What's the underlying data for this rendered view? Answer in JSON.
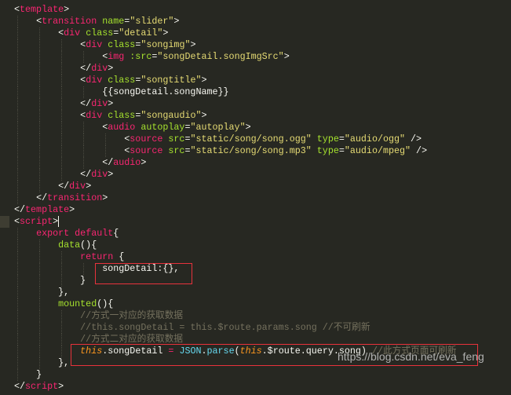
{
  "colors": {
    "background": "#272822",
    "tag": "#F92672",
    "attribute": "#A6E22E",
    "string": "#E6DB74",
    "comment": "#75715E",
    "highlight_box": "#e8323c"
  },
  "code_lines": [
    {
      "indent": 0,
      "tokens": [
        [
          "txt",
          "<"
        ],
        [
          "tag",
          "template"
        ],
        [
          "txt",
          ">"
        ]
      ]
    },
    {
      "indent": 1,
      "tokens": [
        [
          "txt",
          "<"
        ],
        [
          "tag",
          "transition"
        ],
        [
          "txt",
          " "
        ],
        [
          "attr",
          "name"
        ],
        [
          "txt",
          "="
        ],
        [
          "str",
          "\"slider\""
        ],
        [
          "txt",
          ">"
        ]
      ]
    },
    {
      "indent": 2,
      "tokens": [
        [
          "txt",
          "<"
        ],
        [
          "tag",
          "div"
        ],
        [
          "txt",
          " "
        ],
        [
          "attr",
          "class"
        ],
        [
          "txt",
          "="
        ],
        [
          "str",
          "\"detail\""
        ],
        [
          "txt",
          ">"
        ]
      ]
    },
    {
      "indent": 3,
      "tokens": [
        [
          "txt",
          "<"
        ],
        [
          "tag",
          "div"
        ],
        [
          "txt",
          " "
        ],
        [
          "attr",
          "class"
        ],
        [
          "txt",
          "="
        ],
        [
          "str",
          "\"songimg\""
        ],
        [
          "txt",
          ">"
        ]
      ]
    },
    {
      "indent": 4,
      "tokens": [
        [
          "txt",
          "<"
        ],
        [
          "tag",
          "img"
        ],
        [
          "txt",
          " "
        ],
        [
          "attr",
          ":src"
        ],
        [
          "txt",
          "="
        ],
        [
          "str",
          "\"songDetail.songImgSrc\""
        ],
        [
          "txt",
          ">"
        ]
      ]
    },
    {
      "indent": 3,
      "tokens": [
        [
          "txt",
          "</"
        ],
        [
          "tag",
          "div"
        ],
        [
          "txt",
          ">"
        ]
      ]
    },
    {
      "indent": 3,
      "tokens": [
        [
          "txt",
          "<"
        ],
        [
          "tag",
          "div"
        ],
        [
          "txt",
          " "
        ],
        [
          "attr",
          "class"
        ],
        [
          "txt",
          "="
        ],
        [
          "str",
          "\"songtitle\""
        ],
        [
          "txt",
          ">"
        ]
      ]
    },
    {
      "indent": 4,
      "tokens": [
        [
          "txt",
          "{{songDetail.songName}}"
        ]
      ]
    },
    {
      "indent": 3,
      "tokens": [
        [
          "txt",
          "</"
        ],
        [
          "tag",
          "div"
        ],
        [
          "txt",
          ">"
        ]
      ]
    },
    {
      "indent": 3,
      "tokens": [
        [
          "txt",
          "<"
        ],
        [
          "tag",
          "div"
        ],
        [
          "txt",
          " "
        ],
        [
          "attr",
          "class"
        ],
        [
          "txt",
          "="
        ],
        [
          "str",
          "\"songaudio\""
        ],
        [
          "txt",
          ">"
        ]
      ]
    },
    {
      "indent": 4,
      "tokens": [
        [
          "txt",
          "<"
        ],
        [
          "tag",
          "audio"
        ],
        [
          "txt",
          " "
        ],
        [
          "attr",
          "autoplay"
        ],
        [
          "txt",
          "="
        ],
        [
          "str",
          "\"autoplay\""
        ],
        [
          "txt",
          ">"
        ]
      ]
    },
    {
      "indent": 5,
      "tokens": [
        [
          "txt",
          "<"
        ],
        [
          "tag",
          "source"
        ],
        [
          "txt",
          " "
        ],
        [
          "attr",
          "src"
        ],
        [
          "txt",
          "="
        ],
        [
          "str",
          "\"static/song/song.ogg\""
        ],
        [
          "txt",
          " "
        ],
        [
          "attr",
          "type"
        ],
        [
          "txt",
          "="
        ],
        [
          "str",
          "\"audio/ogg\""
        ],
        [
          "txt",
          " />"
        ]
      ]
    },
    {
      "indent": 5,
      "tokens": [
        [
          "txt",
          "<"
        ],
        [
          "tag",
          "source"
        ],
        [
          "txt",
          " "
        ],
        [
          "attr",
          "src"
        ],
        [
          "txt",
          "="
        ],
        [
          "str",
          "\"static/song/song.mp3\""
        ],
        [
          "txt",
          " "
        ],
        [
          "attr",
          "type"
        ],
        [
          "txt",
          "="
        ],
        [
          "str",
          "\"audio/mpeg\""
        ],
        [
          "txt",
          " />"
        ]
      ]
    },
    {
      "indent": 4,
      "tokens": [
        [
          "txt",
          "</"
        ],
        [
          "tag",
          "audio"
        ],
        [
          "txt",
          ">"
        ]
      ]
    },
    {
      "indent": 3,
      "tokens": [
        [
          "txt",
          "</"
        ],
        [
          "tag",
          "div"
        ],
        [
          "txt",
          ">"
        ]
      ]
    },
    {
      "indent": 2,
      "tokens": [
        [
          "txt",
          "</"
        ],
        [
          "tag",
          "div"
        ],
        [
          "txt",
          ">"
        ]
      ]
    },
    {
      "indent": 1,
      "tokens": [
        [
          "txt",
          "</"
        ],
        [
          "tag",
          "transition"
        ],
        [
          "txt",
          ">"
        ]
      ]
    },
    {
      "indent": 0,
      "tokens": [
        [
          "txt",
          "</"
        ],
        [
          "tag",
          "template"
        ],
        [
          "txt",
          ">"
        ]
      ]
    },
    {
      "indent": 0,
      "current": true,
      "tokens": [
        [
          "txt",
          "<"
        ],
        [
          "tag",
          "script"
        ],
        [
          "txt",
          ">"
        ]
      ]
    },
    {
      "indent": 1,
      "tokens": [
        [
          "kw",
          "export"
        ],
        [
          "txt",
          " "
        ],
        [
          "kw",
          "default"
        ],
        [
          "txt",
          "{"
        ]
      ]
    },
    {
      "indent": 2,
      "tokens": [
        [
          "fn",
          "data"
        ],
        [
          "txt",
          "(){"
        ]
      ]
    },
    {
      "indent": 3,
      "tokens": [
        [
          "kw",
          "return"
        ],
        [
          "txt",
          " {"
        ]
      ]
    },
    {
      "indent": 4,
      "tokens": [
        [
          "txt",
          "songDetail:{},"
        ]
      ]
    },
    {
      "indent": 3,
      "tokens": [
        [
          "txt",
          "}"
        ]
      ]
    },
    {
      "indent": 2,
      "tokens": [
        [
          "txt",
          "},"
        ]
      ]
    },
    {
      "indent": 2,
      "tokens": [
        [
          "fn",
          "mounted"
        ],
        [
          "txt",
          "(){"
        ]
      ]
    },
    {
      "indent": 3,
      "tokens": [
        [
          "com",
          "//方式一对应的获取数据"
        ]
      ]
    },
    {
      "indent": 3,
      "tokens": [
        [
          "com",
          "//this.songDetail = this.$route.params.song //不可刷新"
        ]
      ]
    },
    {
      "indent": 3,
      "tokens": [
        [
          "com",
          "//方式二对应的获取数据"
        ]
      ]
    },
    {
      "indent": 3,
      "tokens": [
        [
          "this",
          "this"
        ],
        [
          "txt",
          ".songDetail "
        ],
        [
          "kw",
          "="
        ],
        [
          "txt",
          " "
        ],
        [
          "sup",
          "JSON"
        ],
        [
          "txt",
          "."
        ],
        [
          "sup",
          "parse"
        ],
        [
          "txt",
          "("
        ],
        [
          "this",
          "this"
        ],
        [
          "txt",
          ".$route.query.song) "
        ],
        [
          "com",
          "//此方式页面可刷新"
        ]
      ]
    },
    {
      "indent": 2,
      "tokens": [
        [
          "txt",
          "},"
        ]
      ]
    },
    {
      "indent": 1,
      "tokens": [
        [
          "txt",
          "}"
        ]
      ]
    },
    {
      "indent": 0,
      "tokens": [
        [
          "txt",
          "</"
        ],
        [
          "tag",
          "script"
        ],
        [
          "txt",
          ">"
        ]
      ]
    }
  ],
  "watermark": "https://blog.csdn.net/eva_feng"
}
